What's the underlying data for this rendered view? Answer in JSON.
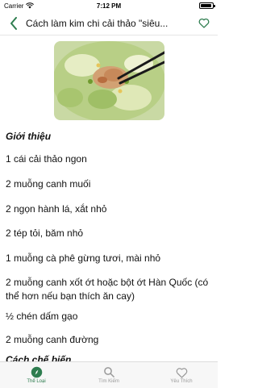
{
  "status_bar": {
    "carrier": "Carrier",
    "time": "7:12 PM"
  },
  "nav": {
    "title": "Cách làm kim chi cải thảo \"siêu..."
  },
  "recipe": {
    "intro_heading": "Giới thiệu",
    "lines": [
      "1 cái cải thảo ngon",
      "2 muỗng canh muối",
      "2 ngọn hành lá, xắt nhỏ",
      "2 tép tỏi, băm nhỏ",
      "1 muỗng cà phê gừng tươi, mài nhỏ",
      "2 muỗng canh xốt ớt hoặc bột ớt Hàn Quốc (có thể hơn nếu bạn thích ăn cay)",
      "½ chén dấm gạo",
      "2 muỗng canh đường"
    ],
    "method_heading": "Cách chế biến"
  },
  "tabbar": {
    "tabs": [
      {
        "label": "Thể Loại",
        "icon": "compass-icon"
      },
      {
        "label": "Tìm Kiếm",
        "icon": "search-icon"
      },
      {
        "label": "Yêu Thích",
        "icon": "heart-icon"
      }
    ]
  },
  "colors": {
    "accent": "#2e7d4f",
    "inactive": "#9a9a9a"
  }
}
